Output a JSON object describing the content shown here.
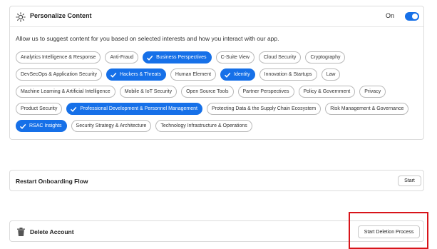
{
  "personalize": {
    "title": "Personalize Content",
    "toggle_label": "On",
    "toggle_on": true,
    "description": "Allow us to suggest content for you based on selected interests and how you interact with our app.",
    "rows": [
      [
        {
          "label": "Analytics Intelligence & Response",
          "selected": false
        },
        {
          "label": "Anti-Fraud",
          "selected": false
        },
        {
          "label": "Business Perspectives",
          "selected": true
        },
        {
          "label": "C-Suite View",
          "selected": false
        },
        {
          "label": "Cloud Security",
          "selected": false
        },
        {
          "label": "Cryptography",
          "selected": false
        }
      ],
      [
        {
          "label": "DevSecOps & Application Security",
          "selected": false
        },
        {
          "label": "Hackers & Threats",
          "selected": true
        },
        {
          "label": "Human Element",
          "selected": false
        },
        {
          "label": "Identity",
          "selected": true
        },
        {
          "label": "Innovation & Startups",
          "selected": false
        },
        {
          "label": "Law",
          "selected": false
        }
      ],
      [
        {
          "label": "Machine Learning & Artificial Intelligence",
          "selected": false
        },
        {
          "label": "Mobile & IoT Security",
          "selected": false
        },
        {
          "label": "Open Source Tools",
          "selected": false
        },
        {
          "label": "Partner Perspectives",
          "selected": false
        },
        {
          "label": "Policy & Government",
          "selected": false
        },
        {
          "label": "Privacy",
          "selected": false
        }
      ],
      [
        {
          "label": "Product Security",
          "selected": false
        },
        {
          "label": "Professional Development & Personnel Management",
          "selected": true
        },
        {
          "label": "Protecting Data & the Supply Chain Ecosystem",
          "selected": false
        },
        {
          "label": "Risk Management & Governance",
          "selected": false
        }
      ],
      [
        {
          "label": "RSAC Insights",
          "selected": true
        },
        {
          "label": "Security Strategy & Architecture",
          "selected": false
        },
        {
          "label": "Technology Infrastructure & Operations",
          "selected": false
        }
      ]
    ]
  },
  "onboarding": {
    "title": "Restart Onboarding Flow",
    "button_label": "Start"
  },
  "delete_account": {
    "title": "Delete Account",
    "button_label": "Start Deletion Process"
  },
  "colors": {
    "accent": "#1670e8",
    "highlight": "#d8141a",
    "border": "#dcdcdc"
  }
}
